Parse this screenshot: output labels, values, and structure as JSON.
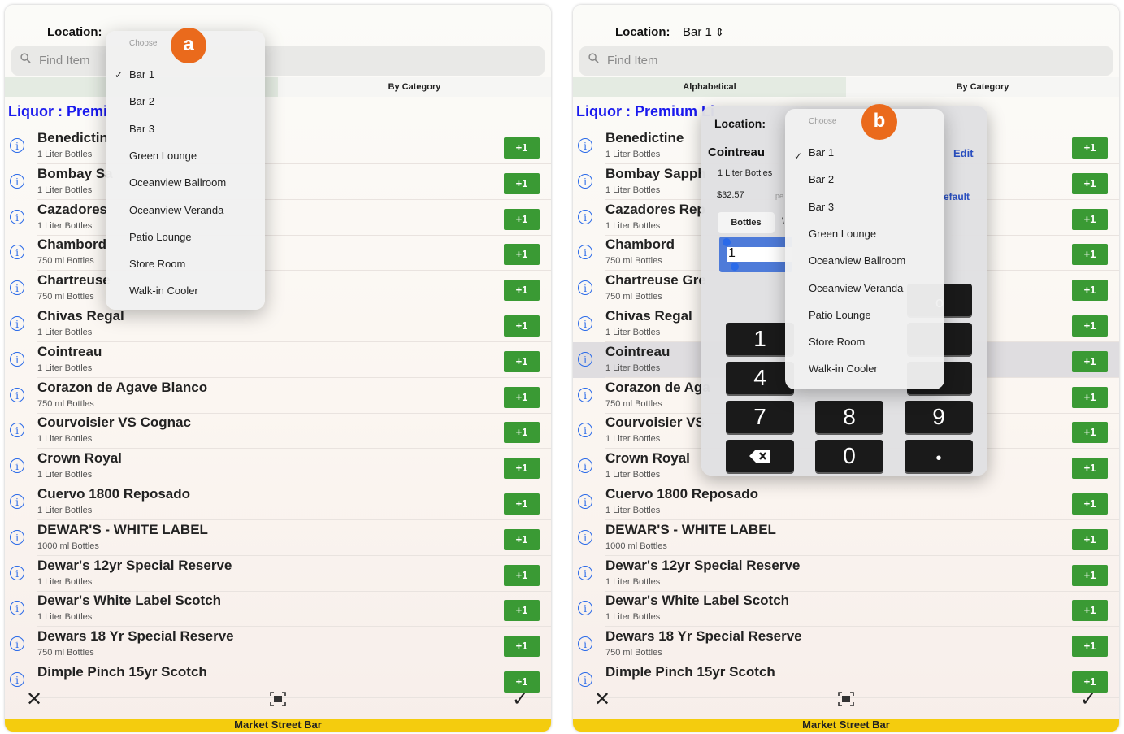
{
  "screens": [
    {
      "location_label": "Location:",
      "location_value": "",
      "search_placeholder": "Find Item",
      "segments": [
        "",
        "By Category"
      ],
      "category_title": "Liquor : Premi",
      "rows": [
        {
          "name": "Benedictin",
          "unit": "1 Liter Bottles",
          "action": "+1"
        },
        {
          "name": "Bombay Sa",
          "unit": "1 Liter Bottles",
          "action": "+1"
        },
        {
          "name": "Cazadores",
          "unit": "1 Liter Bottles",
          "action": "+1"
        },
        {
          "name": "Chambord",
          "unit": "750 ml Bottles",
          "action": "+1"
        },
        {
          "name": "Chartreuse",
          "unit": "750 ml Bottles",
          "action": "+1"
        },
        {
          "name": "Chivas Regal",
          "unit": "1 Liter Bottles",
          "action": "+1"
        },
        {
          "name": "Cointreau",
          "unit": "1 Liter Bottles",
          "action": "+1"
        },
        {
          "name": "Corazon de Agave Blanco",
          "unit": "750 ml Bottles",
          "action": "+1"
        },
        {
          "name": "Courvoisier VS Cognac",
          "unit": "1 Liter Bottles",
          "action": "+1"
        },
        {
          "name": "Crown Royal",
          "unit": "1 Liter Bottles",
          "action": "+1"
        },
        {
          "name": "Cuervo 1800 Reposado",
          "unit": "1 Liter Bottles",
          "action": "+1"
        },
        {
          "name": "DEWAR'S - WHITE LABEL",
          "unit": "1000 ml Bottles",
          "action": "+1"
        },
        {
          "name": "Dewar's 12yr Special Reserve",
          "unit": "1 Liter Bottles",
          "action": "+1"
        },
        {
          "name": "Dewar's White Label Scotch",
          "unit": "1 Liter Bottles",
          "action": "+1"
        },
        {
          "name": "Dewars 18 Yr Special Reserve",
          "unit": "750 ml Bottles",
          "action": "+1"
        },
        {
          "name": "Dimple Pinch 15yr Scotch",
          "unit": "",
          "action": "+1"
        }
      ],
      "bottom_label": "Market Street Bar",
      "popup": {
        "badge": "a",
        "choose_label": "Choose",
        "options": [
          "Bar 1",
          "Bar 2",
          "Bar 3",
          "Green Lounge",
          "Oceanview Ballroom",
          "Oceanview Veranda",
          "Patio Lounge",
          "Store Room",
          "Walk-in Cooler"
        ],
        "selected": "Bar 1"
      }
    },
    {
      "location_label": "Location:",
      "location_value": "Bar 1",
      "search_placeholder": "Find Item",
      "segments": [
        "Alphabetical",
        "By Category"
      ],
      "category_title": "Liquor : Premium Li",
      "rows": [
        {
          "name": "Benedictine",
          "unit": "1 Liter Bottles",
          "action": "+1"
        },
        {
          "name": "Bombay Sapph",
          "unit": "1 Liter Bottles",
          "action": "+1"
        },
        {
          "name": "Cazadores Rep",
          "unit": "1 Liter Bottles",
          "action": "+1"
        },
        {
          "name": "Chambord",
          "unit": "750 ml Bottles",
          "action": "+1"
        },
        {
          "name": "Chartreuse Gre",
          "unit": "750 ml Bottles",
          "action": "+1"
        },
        {
          "name": "Chivas Regal",
          "unit": "1 Liter Bottles",
          "action": "+1"
        },
        {
          "name": "Cointreau",
          "unit": "1 Liter Bottles",
          "action": "+1"
        },
        {
          "name": "Corazon de Aga",
          "unit": "750 ml Bottles",
          "action": "+1"
        },
        {
          "name": "Courvoisier VS",
          "unit": "1 Liter Bottles",
          "action": "+1"
        },
        {
          "name": "Crown Royal",
          "unit": "1 Liter Bottles",
          "action": "+1"
        },
        {
          "name": "Cuervo 1800 Reposado",
          "unit": "1 Liter Bottles",
          "action": "+1"
        },
        {
          "name": "DEWAR'S - WHITE LABEL",
          "unit": "1000 ml Bottles",
          "action": "+1"
        },
        {
          "name": "Dewar's 12yr Special Reserve",
          "unit": "1 Liter Bottles",
          "action": "+1"
        },
        {
          "name": "Dewar's White Label Scotch",
          "unit": "1 Liter Bottles",
          "action": "+1"
        },
        {
          "name": "Dewars 18 Yr Special Reserve",
          "unit": "750 ml Bottles",
          "action": "+1"
        },
        {
          "name": "Dimple Pinch 15yr Scotch",
          "unit": "",
          "action": "+1"
        }
      ],
      "bottom_label": "Market Street Bar",
      "popup": {
        "badge": "b",
        "choose_label": "Choose",
        "options": [
          "Bar 1",
          "Bar 2",
          "Bar 3",
          "Green Lounge",
          "Oceanview Ballroom",
          "Oceanview Veranda",
          "Patio Lounge",
          "Store Room",
          "Walk-in Cooler"
        ],
        "selected": "Bar 1"
      },
      "editor": {
        "location_label": "Location:",
        "item_name": "Cointreau",
        "item_unit": "1 Liter Bottles",
        "item_price": "$32.57",
        "price_suffix": "pe",
        "edit_label": "Edit",
        "default_label": "efault",
        "tab_label": "Bottles",
        "tab_suffix": "\\",
        "qty_value": "1",
        "keys": [
          "1",
          "4",
          "7",
          "8",
          "9",
          "0",
          "•"
        ],
        "key_partial": "o"
      }
    }
  ],
  "colors": {
    "accent_blue": "#1a1aee",
    "plus_green": "#3a9a34",
    "badge_orange": "#ea6a1c",
    "bottom_bar_yellow": "#f4cc0e"
  }
}
